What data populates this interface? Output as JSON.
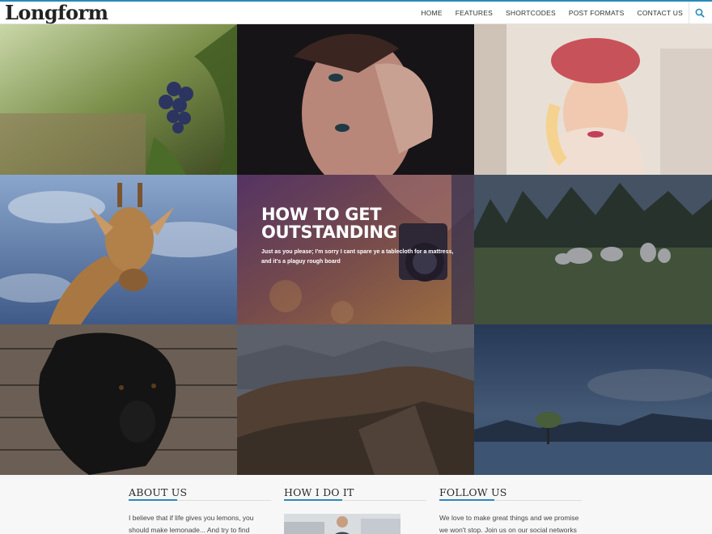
{
  "site": {
    "logo": "Longform"
  },
  "nav": {
    "items": [
      "HOME",
      "FEATURES",
      "SHORTCODES",
      "POST FORMATS",
      "CONTACT US"
    ],
    "search_icon": "search-icon"
  },
  "feature": {
    "title": "HOW TO GET OUTSTANDING",
    "excerpt": "Just as you please; I'm sorry I cant spare ye a tablecloth for a mattress, and it's a plaguy rough board"
  },
  "tiles": [
    "grapes-photo",
    "woman-lips-photo",
    "woman-hat-photo",
    "giraffe-photo",
    "camera-photo",
    "sheep-photo",
    "dog-photo",
    "mountains-photo",
    "lake-tree-photo"
  ],
  "footer": {
    "about": {
      "title": "ABOUT US",
      "text": "I believe that if life gives you lemons, you should make lemonade... And try to find somebody"
    },
    "how": {
      "title": "HOW I DO IT"
    },
    "follow": {
      "title": "FOLLOW US",
      "text": "We love to make great things and we promise we won't stop. Join us on our social networks"
    }
  },
  "colors": {
    "accent": "#2a8ab8"
  }
}
